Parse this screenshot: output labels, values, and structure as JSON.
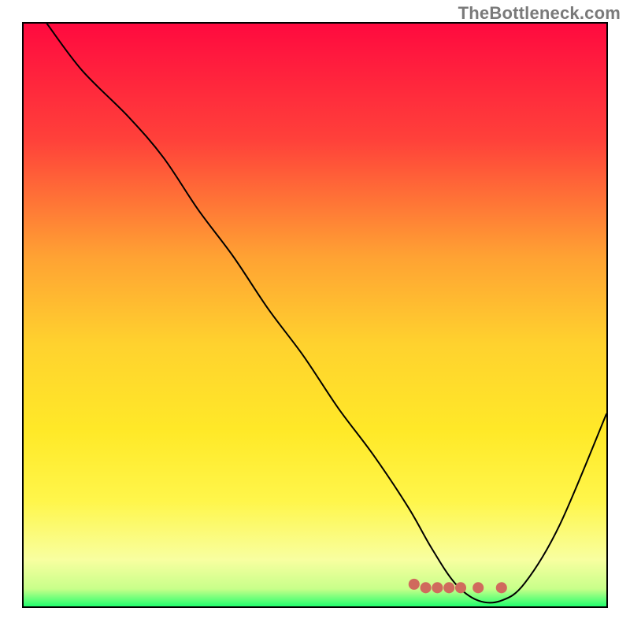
{
  "watermark": "TheBottleneck.com",
  "chart_data": {
    "type": "line",
    "title": "",
    "xlabel": "",
    "ylabel": "",
    "xlim": [
      0,
      100
    ],
    "ylim": [
      0,
      100
    ],
    "grid": false,
    "legend": false,
    "gradient_stops": [
      {
        "pos": 0.0,
        "color": "#ff0a3f"
      },
      {
        "pos": 0.2,
        "color": "#ff413a"
      },
      {
        "pos": 0.4,
        "color": "#ffa233"
      },
      {
        "pos": 0.55,
        "color": "#ffd22e"
      },
      {
        "pos": 0.7,
        "color": "#ffe928"
      },
      {
        "pos": 0.82,
        "color": "#fff64b"
      },
      {
        "pos": 0.92,
        "color": "#f8ffa0"
      },
      {
        "pos": 0.97,
        "color": "#c8ff8a"
      },
      {
        "pos": 1.0,
        "color": "#22ff6e"
      }
    ],
    "series": [
      {
        "name": "bottleneck-curve",
        "x": [
          4,
          10,
          18,
          24,
          30,
          36,
          42,
          48,
          54,
          60,
          66,
          70,
          74,
          78,
          82,
          86,
          92,
          100
        ],
        "values": [
          100,
          92,
          84,
          77,
          68,
          60,
          51,
          43,
          34,
          26,
          17,
          10,
          4,
          1,
          1,
          4,
          14,
          33
        ]
      }
    ],
    "markers": {
      "name": "highlight-dots",
      "color": "#d06a5d",
      "points": [
        {
          "x": 67,
          "y": 3.8
        },
        {
          "x": 69,
          "y": 3.2
        },
        {
          "x": 71,
          "y": 3.2
        },
        {
          "x": 73,
          "y": 3.2
        },
        {
          "x": 75,
          "y": 3.2
        },
        {
          "x": 78,
          "y": 3.2
        },
        {
          "x": 82,
          "y": 3.2
        }
      ]
    }
  }
}
